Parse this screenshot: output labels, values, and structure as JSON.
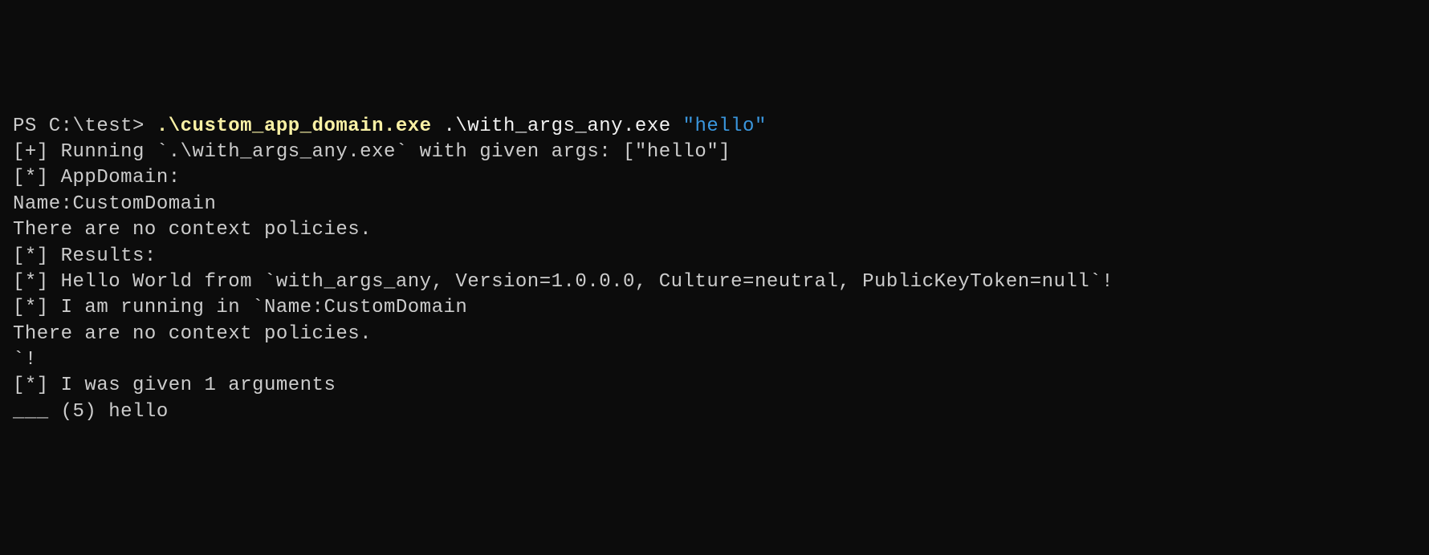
{
  "prompt": {
    "ps_prefix": "PS C:\\test> ",
    "exe1": ".\\custom_app_domain.exe",
    "exe2": " .\\with_args_any.exe ",
    "arg_quoted": "\"hello\""
  },
  "output": {
    "line1": "[+] Running `.\\with_args_any.exe` with given args: [\"hello\"]",
    "line2": "[*] AppDomain:",
    "line3": "",
    "line4": "Name:CustomDomain",
    "line5": "There are no context policies.",
    "line6": "",
    "line7": "[*] Results:",
    "line8": "",
    "line9": "[*] Hello World from `with_args_any, Version=1.0.0.0, Culture=neutral, PublicKeyToken=null`!",
    "line10": "[*] I am running in `Name:CustomDomain",
    "line11": "There are no context policies.",
    "line12": "`!",
    "line13": "[*] I was given 1 arguments",
    "line14": "___ (5) hello"
  }
}
